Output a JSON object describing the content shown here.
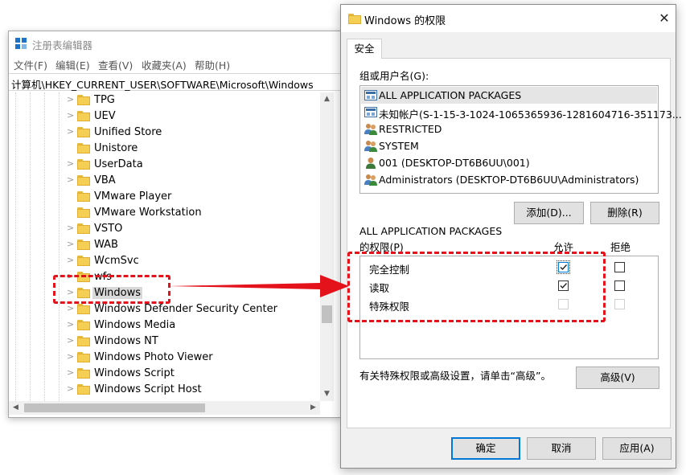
{
  "registry": {
    "title": "注册表编辑器",
    "menu": [
      "文件(F)",
      "编辑(E)",
      "查看(V)",
      "收藏夹(A)",
      "帮助(H)"
    ],
    "address": "计算机\\HKEY_CURRENT_USER\\SOFTWARE\\Microsoft\\Windows",
    "tree_items": [
      {
        "label": "TPG",
        "expandable": true
      },
      {
        "label": "UEV",
        "expandable": true
      },
      {
        "label": "Unified Store",
        "expandable": true
      },
      {
        "label": "Unistore",
        "expandable": false
      },
      {
        "label": "UserData",
        "expandable": true
      },
      {
        "label": "VBA",
        "expandable": true
      },
      {
        "label": "VMware Player",
        "expandable": false
      },
      {
        "label": "VMware Workstation",
        "expandable": false
      },
      {
        "label": "VSTO",
        "expandable": true
      },
      {
        "label": "WAB",
        "expandable": true
      },
      {
        "label": "WcmSvc",
        "expandable": true
      },
      {
        "label": "wfs",
        "expandable": true
      },
      {
        "label": "Windows",
        "expandable": true,
        "selected": true
      },
      {
        "label": "Windows Defender Security Center",
        "expandable": true
      },
      {
        "label": "Windows Media",
        "expandable": true
      },
      {
        "label": "Windows NT",
        "expandable": true
      },
      {
        "label": "Windows Photo Viewer",
        "expandable": true
      },
      {
        "label": "Windows Script",
        "expandable": true
      },
      {
        "label": "Windows Script Host",
        "expandable": true
      }
    ]
  },
  "dialog": {
    "title": "Windows 的权限",
    "close_glyph": "✕",
    "tab_security": "安全",
    "users_label": "组或用户名(G):",
    "users": [
      {
        "name": "ALL APPLICATION PACKAGES",
        "icon": "app-package-icon",
        "selected": true
      },
      {
        "name": "未知帐户(S-1-15-3-1024-1065365936-1281604716-351173...",
        "icon": "app-package-icon"
      },
      {
        "name": "RESTRICTED",
        "icon": "group-icon"
      },
      {
        "name": "SYSTEM",
        "icon": "group-icon"
      },
      {
        "name": "001 (DESKTOP-DT6B6UU\\001)",
        "icon": "user-icon"
      },
      {
        "name": "Administrators (DESKTOP-DT6B6UU\\Administrators)",
        "icon": "group-icon"
      }
    ],
    "add_label": "添加(D)...",
    "remove_label": "删除(R)",
    "perm_for_label": "ALL APPLICATION PACKAGES",
    "perm_label": "的权限(P)",
    "allow_label": "允许",
    "deny_label": "拒绝",
    "permissions": [
      {
        "name": "完全控制",
        "allow": true,
        "deny": false,
        "enabled": true
      },
      {
        "name": "读取",
        "allow": true,
        "deny": false,
        "enabled": true
      },
      {
        "name": "特殊权限",
        "allow": false,
        "deny": false,
        "enabled": false
      }
    ],
    "advanced_note": "有关特殊权限或高级设置，请单击“高级”。",
    "advanced_label": "高级(V)",
    "ok_label": "确定",
    "cancel_label": "取消",
    "apply_label": "应用(A)"
  },
  "colors": {
    "annotation": "#e4121b",
    "folder": "#f5cf53",
    "accent": "#0078d7"
  }
}
